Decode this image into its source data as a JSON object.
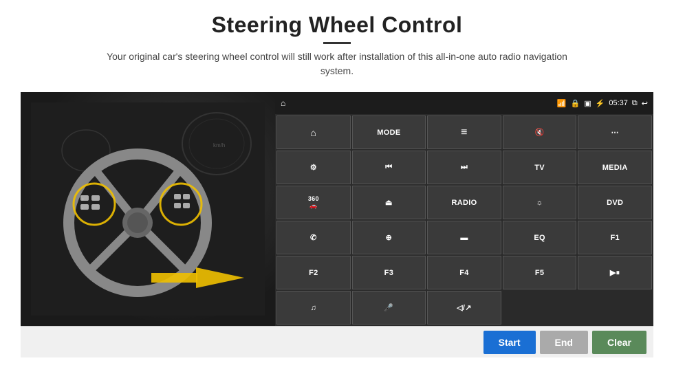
{
  "header": {
    "title": "Steering Wheel Control",
    "divider": true,
    "subtitle": "Your original car's steering wheel control will still work after installation of this all-in-one auto radio navigation system."
  },
  "status_bar": {
    "time": "05:37",
    "icons": [
      "wifi",
      "lock",
      "sim",
      "bluetooth",
      "mirror",
      "back"
    ]
  },
  "buttons": [
    {
      "id": "home",
      "label": "",
      "icon": "home"
    },
    {
      "id": "mode",
      "label": "MODE"
    },
    {
      "id": "list",
      "label": "",
      "icon": "list"
    },
    {
      "id": "mute",
      "label": "",
      "icon": "mute"
    },
    {
      "id": "apps",
      "label": "",
      "icon": "apps"
    },
    {
      "id": "nav",
      "label": "",
      "icon": "nav"
    },
    {
      "id": "prev",
      "label": "",
      "icon": "prev"
    },
    {
      "id": "next",
      "label": "",
      "icon": "next"
    },
    {
      "id": "tv",
      "label": "TV"
    },
    {
      "id": "media",
      "label": "MEDIA"
    },
    {
      "id": "360",
      "label": "",
      "icon": "360"
    },
    {
      "id": "eject",
      "label": "",
      "icon": "eject"
    },
    {
      "id": "radio",
      "label": "RADIO"
    },
    {
      "id": "brightness",
      "label": "",
      "icon": "sun"
    },
    {
      "id": "dvd",
      "label": "DVD"
    },
    {
      "id": "phone",
      "label": "",
      "icon": "phone"
    },
    {
      "id": "browser",
      "label": "",
      "icon": "browser"
    },
    {
      "id": "rect",
      "label": "",
      "icon": "rect"
    },
    {
      "id": "eq",
      "label": "EQ"
    },
    {
      "id": "f1",
      "label": "F1"
    },
    {
      "id": "f2",
      "label": "F2"
    },
    {
      "id": "f3",
      "label": "F3"
    },
    {
      "id": "f4",
      "label": "F4"
    },
    {
      "id": "f5",
      "label": "F5"
    },
    {
      "id": "playpause",
      "label": "",
      "icon": "playpause"
    },
    {
      "id": "music",
      "label": "",
      "icon": "music"
    },
    {
      "id": "mic",
      "label": "",
      "icon": "mic"
    },
    {
      "id": "vol",
      "label": "",
      "icon": "vol"
    }
  ],
  "action_buttons": {
    "start": "Start",
    "end": "End",
    "clear": "Clear"
  }
}
